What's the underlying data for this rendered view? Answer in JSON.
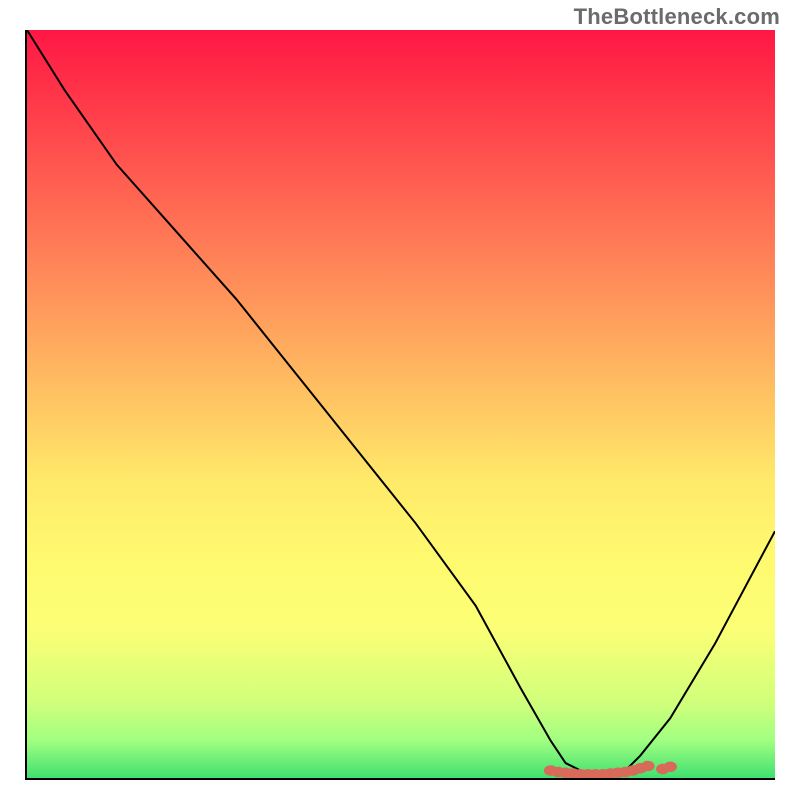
{
  "watermark": "TheBottleneck.com",
  "chart_data": {
    "type": "line",
    "title": "",
    "xlabel": "",
    "ylabel": "",
    "xlim": [
      0,
      100
    ],
    "ylim": [
      0,
      100
    ],
    "grid": false,
    "series": [
      {
        "name": "bottleneck-curve",
        "color": "#000000",
        "x": [
          0,
          5,
          12,
          20,
          28,
          36,
          44,
          52,
          60,
          66,
          70,
          72,
          74,
          76,
          78,
          80,
          82,
          86,
          92,
          100
        ],
        "y": [
          100,
          92,
          82,
          73,
          64,
          54,
          44,
          34,
          23,
          12,
          5,
          2,
          1,
          0,
          0,
          1,
          3,
          8,
          18,
          33
        ]
      }
    ],
    "annotations": [
      {
        "name": "optimal-region",
        "type": "marker",
        "color": "#d86a5a",
        "x": [
          70,
          71,
          72,
          73,
          74,
          75,
          76,
          77,
          78,
          79,
          80,
          81,
          82,
          83,
          85,
          86
        ],
        "y": [
          1.0,
          0.8,
          0.7,
          0.6,
          0.5,
          0.5,
          0.5,
          0.5,
          0.6,
          0.7,
          0.8,
          1.0,
          1.3,
          1.6,
          1.2,
          1.5
        ]
      }
    ],
    "background": {
      "type": "vertical-gradient",
      "stops": [
        {
          "pct": 0,
          "color": "#ff1744"
        },
        {
          "pct": 10,
          "color": "#ff3a4a"
        },
        {
          "pct": 20,
          "color": "#ff5d50"
        },
        {
          "pct": 30,
          "color": "#ff8057"
        },
        {
          "pct": 40,
          "color": "#ffa35d"
        },
        {
          "pct": 50,
          "color": "#ffc663"
        },
        {
          "pct": 60,
          "color": "#ffe969"
        },
        {
          "pct": 70,
          "color": "#fff96f"
        },
        {
          "pct": 80,
          "color": "#fcff75"
        },
        {
          "pct": 90,
          "color": "#d0ff7b"
        },
        {
          "pct": 95,
          "color": "#a0ff81"
        },
        {
          "pct": 100,
          "color": "#40e070"
        }
      ]
    }
  }
}
